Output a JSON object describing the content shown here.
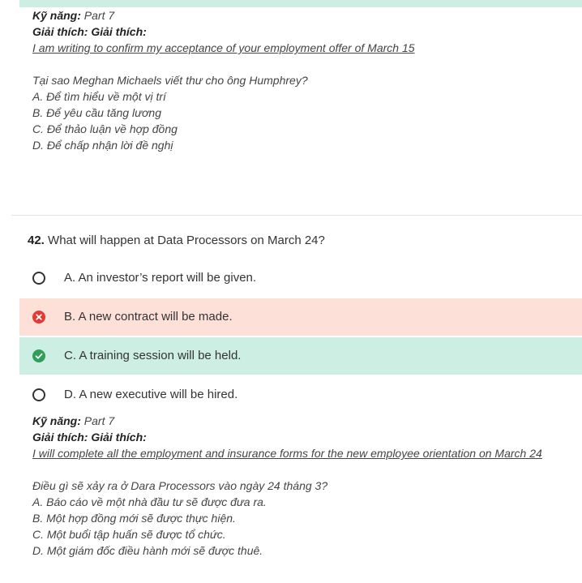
{
  "previous": {
    "skill_label": "Kỹ năng:",
    "skill_value": "Part 7",
    "explain_label": "Giải thích: Giải thích:",
    "quote": "I am writing to confirm my acceptance of your employment offer of March 15",
    "translated_question": "Tại sao Meghan Michaels viết thư cho ông Humphrey?",
    "translated_options": [
      "A. Để tìm hiểu về một vị trí",
      "B. Để yêu cầu tăng lương",
      "C. Để thảo luận về hợp đồng",
      "D. Để chấp nhận lời đề nghị"
    ]
  },
  "question": {
    "number": "42.",
    "text": "What will happen at Data Processors on March 24?",
    "options": [
      {
        "label": "A. An investor’s report will be given.",
        "state": "unselected"
      },
      {
        "label": "B. A new contract will be made.",
        "state": "wrong"
      },
      {
        "label": "C. A training session will be held.",
        "state": "correct"
      },
      {
        "label": "D. A new executive will be hired.",
        "state": "unselected"
      }
    ],
    "skill_label": "Kỹ năng:",
    "skill_value": "Part 7",
    "explain_label": "Giải thích: Giải thích:",
    "quote": "I will complete all the employment and insurance forms for the new employee orientation on March 24",
    "translated_question": "Điều gì sẽ xảy ra ở Dara Processors vào ngày 24 tháng 3?",
    "translated_options": [
      "A. Báo cáo về một nhà đầu tư sẽ được đưa ra.",
      "B. Một hợp đồng mới sẽ được thực hiện.",
      "C. Một buổi tập huấn sẽ được tổ chức.",
      "D. Một giám đốc điều hành mới sẽ được thuê."
    ]
  },
  "colors": {
    "correct_bg": "#cdeee2",
    "wrong_bg": "#fde0d8",
    "correct_icon": "#2e9e5b",
    "wrong_icon": "#e53935"
  }
}
